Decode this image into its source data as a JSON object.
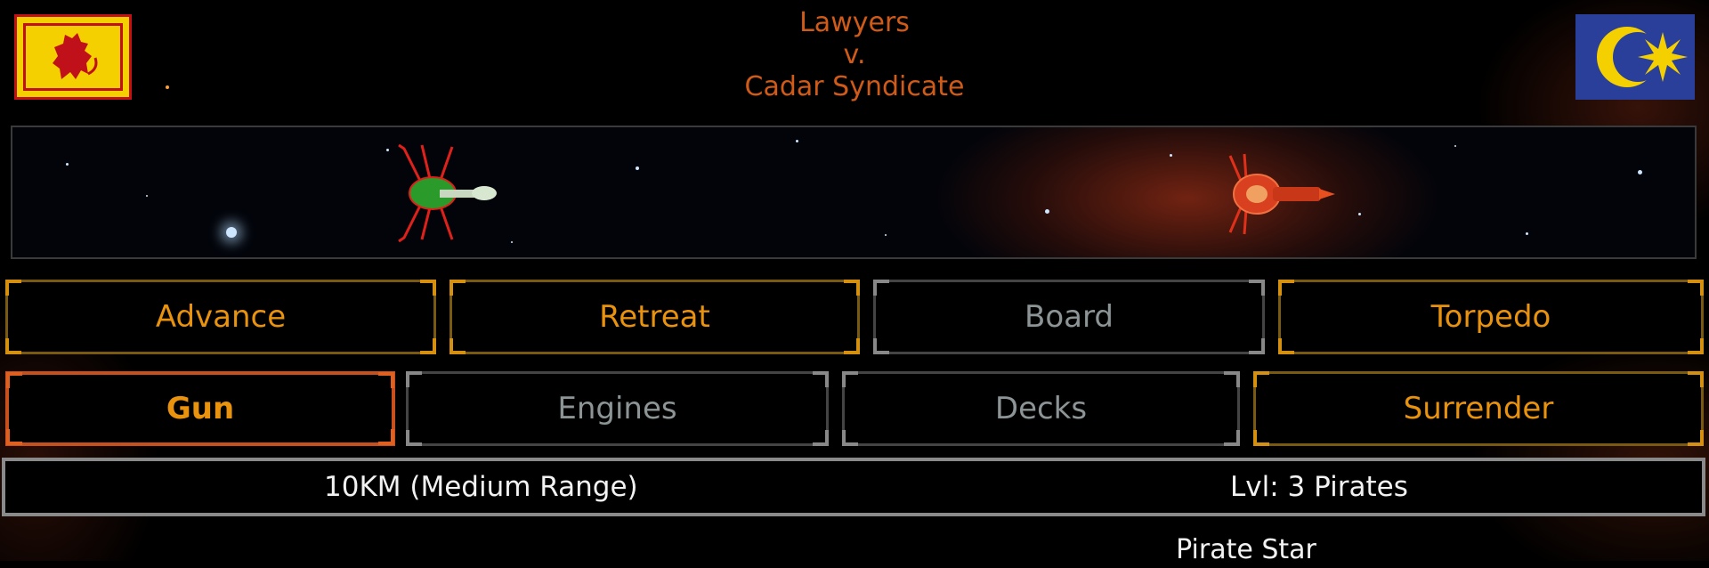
{
  "combat": {
    "player_name": "Lawyers",
    "versus": "v.",
    "enemy_name": "Cadar Syndicate",
    "player_flag": "scotland-lion-rampant-flag",
    "enemy_flag": "malaysia-crescent-star-flag"
  },
  "action_buttons": [
    {
      "label": "Advance",
      "state": "enabled"
    },
    {
      "label": "Retreat",
      "state": "enabled"
    },
    {
      "label": "Board",
      "state": "disabled"
    },
    {
      "label": "Torpedo",
      "state": "enabled"
    }
  ],
  "target_buttons": [
    {
      "label": "Gun",
      "state": "selected"
    },
    {
      "label": "Engines",
      "state": "disabled"
    },
    {
      "label": "Decks",
      "state": "disabled"
    },
    {
      "label": "Surrender",
      "state": "enabled"
    }
  ],
  "status": {
    "range": "10KM (Medium Range)",
    "enemy_level": "Lvl: 3 Pirates"
  },
  "enemy_ship_name": "Pirate Star",
  "colors": {
    "title": "#d05a18",
    "button_text_enabled": "#e8920e",
    "button_text_disabled": "#8c9496",
    "selected_border": "#c8501c"
  }
}
